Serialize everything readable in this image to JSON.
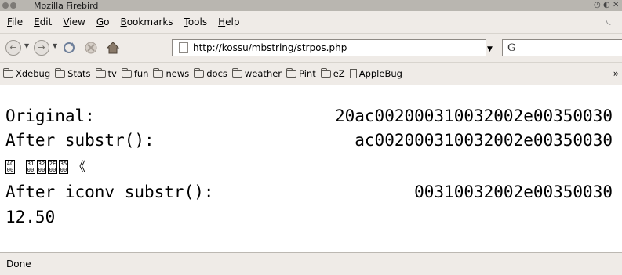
{
  "window": {
    "title": "Mozilla Firebird"
  },
  "menubar": [
    {
      "label": "File"
    },
    {
      "label": "Edit"
    },
    {
      "label": "View"
    },
    {
      "label": "Go"
    },
    {
      "label": "Bookmarks"
    },
    {
      "label": "Tools"
    },
    {
      "label": "Help"
    }
  ],
  "navbar": {
    "url": "http://kossu/mbstring/strpos.php",
    "search_engine_glyph": "G"
  },
  "bookmarks": [
    {
      "label": "Xdebug",
      "type": "folder"
    },
    {
      "label": "Stats",
      "type": "folder"
    },
    {
      "label": "tv",
      "type": "folder"
    },
    {
      "label": "fun",
      "type": "folder"
    },
    {
      "label": "news",
      "type": "folder"
    },
    {
      "label": "docs",
      "type": "folder"
    },
    {
      "label": "weather",
      "type": "folder"
    },
    {
      "label": "Pint",
      "type": "folder"
    },
    {
      "label": "eZ",
      "type": "folder"
    },
    {
      "label": "AppleBug",
      "type": "page"
    }
  ],
  "bookmarks_overflow": "»",
  "content": {
    "original_label": "Original:",
    "original_value": "20ac002000310032002e00350030",
    "substr_label": "After substr():",
    "substr_value": "ac002000310032002e00350030",
    "garbled_glyphs": [
      "AC 00",
      "31 00",
      "32 00",
      "2E 00",
      "35 00"
    ],
    "garbled_tail": "《",
    "iconv_label": "After iconv_substr():",
    "iconv_value": "00310032002e00350030",
    "result_value": "12.50"
  },
  "status": {
    "text": "Done"
  }
}
